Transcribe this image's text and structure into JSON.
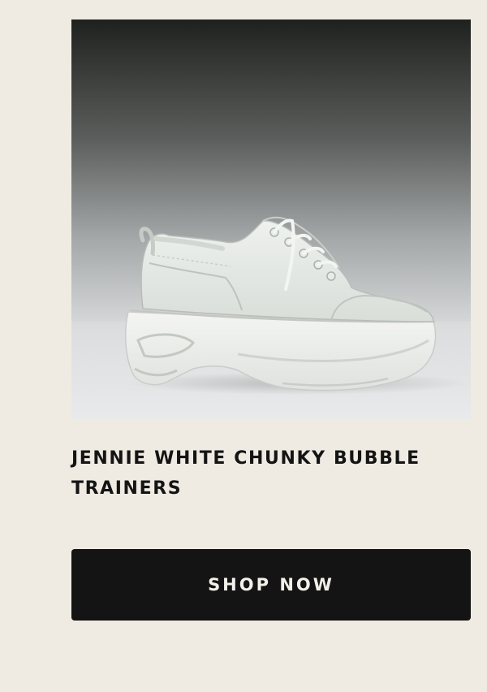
{
  "product": {
    "title": "JENNIE WHITE CHUNKY BUBBLE TRAINERS",
    "image_subject": "white chunky platform lace-up trainer on grey gradient background"
  },
  "cta": {
    "label": "SHOP NOW"
  },
  "colors": {
    "page_background": "#efebe2",
    "button_background": "#141415",
    "button_text": "#f3f0ea",
    "title_text": "#141414"
  }
}
